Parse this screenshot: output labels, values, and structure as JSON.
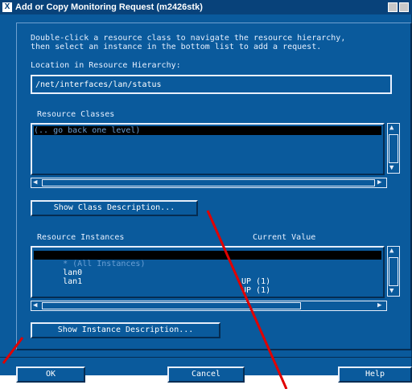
{
  "window": {
    "title": "Add or Copy Monitoring Request (m2426stk)",
    "app_icon": "X"
  },
  "instructions": {
    "line1": "Double-click a resource class to navigate the resource hierarchy,",
    "line2": "then select an instance in the bottom list to add a request."
  },
  "location": {
    "label": "Location in Resource Hierarchy:",
    "value": "/net/interfaces/lan/status"
  },
  "resource_classes": {
    "label": "Resource Classes",
    "items": [
      "(.. go back one level)"
    ],
    "selected_index": 0
  },
  "show_class_description": "Show Class Description...",
  "resource_instances": {
    "label": "Resource Instances",
    "value_header": "Current Value",
    "rows": [
      {
        "name": "* (All Instances)",
        "value": ""
      },
      {
        "name": "lan0",
        "value": "UP (1)"
      },
      {
        "name": "lan1",
        "value": "UP (1)"
      }
    ],
    "selected_index": 0
  },
  "show_instance_description": "Show Instance Description...",
  "buttons": {
    "ok": "OK",
    "cancel": "Cancel",
    "help": "Help"
  },
  "annotation_color": "#e00000"
}
